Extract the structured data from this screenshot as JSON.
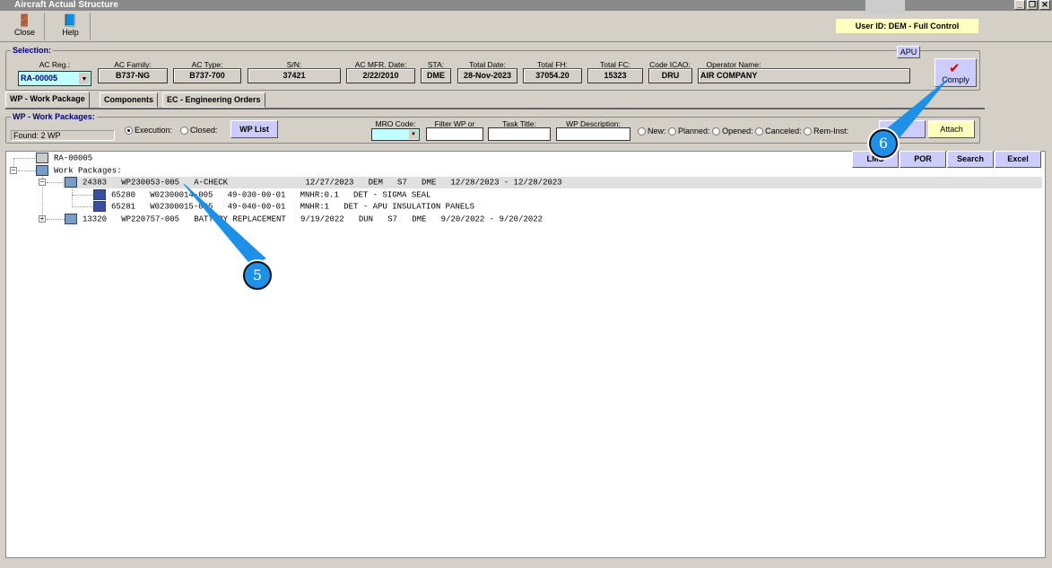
{
  "window": {
    "title": "Aircraft Actual Structure",
    "min": "_",
    "max": "❐",
    "close": "✕"
  },
  "toolbar": {
    "close": "Close",
    "help": "Help"
  },
  "user": "User ID: DEM - Full Control",
  "selection": {
    "label": "Selection:",
    "ac_reg": {
      "label": "AC Reg.:",
      "value": "RA-00005"
    },
    "ac_family": {
      "label": "AC Family:",
      "value": "B737-NG"
    },
    "ac_type": {
      "label": "AC Type:",
      "value": "B737-700"
    },
    "sn": {
      "label": "S/N:",
      "value": "37421"
    },
    "mfr_date": {
      "label": "AC MFR. Date:",
      "value": "2/22/2010"
    },
    "sta": {
      "label": "STA:",
      "value": "DME"
    },
    "total_date": {
      "label": "Total Date:",
      "value": "28-Nov-2023"
    },
    "total_fh": {
      "label": "Total FH:",
      "value": "37054.20"
    },
    "total_fc": {
      "label": "Total FC:",
      "value": "15323"
    },
    "icao": {
      "label": "Code ICAO:",
      "value": "DRU"
    },
    "operator": {
      "label": "Operator Name:",
      "value": "AIR COMPANY"
    },
    "apu": "APU",
    "comply": "Comply"
  },
  "tabs": [
    "WP - Work Package",
    "Components",
    "EC - Engineering Orders"
  ],
  "wp": {
    "label": "WP - Work Packages:",
    "found": "Found: 2 WP",
    "execution": "Execution:",
    "closed": "Closed:",
    "wp_list": "WP List",
    "mro_code": "MRO Code:",
    "filter": "Filter WP or Task:",
    "task_title": "Task Title:",
    "wp_desc": "WP Description:",
    "statuses": [
      "New:",
      "Planned:",
      "Opened:",
      "Canceled:",
      "Rem-Inst:"
    ],
    "attach": "Attach",
    "buttons": [
      "LMS",
      "POR",
      "Search",
      "Excel"
    ]
  },
  "tree": {
    "root": "RA-00005",
    "wp_folder": "Work Packages:",
    "rows": [
      "24383   WP230053-005   A-CHECK                12/27/2023   DEM   S7   DME   12/28/2023 - 12/28/2023",
      "65280   W02300014-005   49-030-00-01   MNHR:0.1   DET - SIGMA SEAL",
      "65281   W02300015-005   49-040-00-01   MNHR:1   DET - APU INSULATION PANELS",
      "13320   WP220757-005   BATTERY REPLACEMENT   9/19/2022   DUN   S7   DME   9/20/2022 - 9/20/2022"
    ]
  },
  "callouts": [
    "5",
    "6"
  ],
  "colors": {
    "accent_button": "#ccccff",
    "user_bg": "#ffffc0",
    "callout": "#1e90e8",
    "reg_bg": "#c0ffff"
  }
}
